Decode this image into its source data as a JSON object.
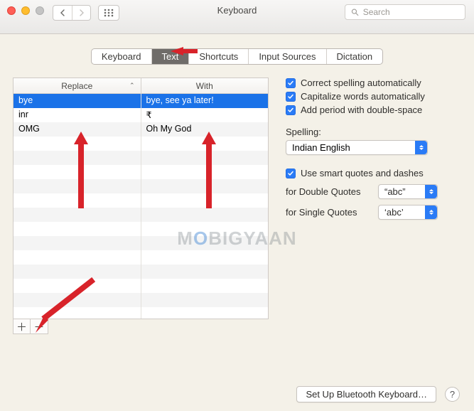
{
  "window": {
    "title": "Keyboard"
  },
  "search": {
    "placeholder": "Search"
  },
  "tabs": [
    "Keyboard",
    "Text",
    "Shortcuts",
    "Input Sources",
    "Dictation"
  ],
  "active_tab_index": 1,
  "replace_table": {
    "headers": {
      "replace": "Replace",
      "with": "With"
    },
    "rows": [
      {
        "replace": "bye",
        "with": "bye, see ya later!",
        "selected": true
      },
      {
        "replace": "inr",
        "with": "₹",
        "selected": false
      },
      {
        "replace": "OMG",
        "with": "Oh My God",
        "selected": false
      }
    ]
  },
  "options": {
    "correct_spelling": {
      "label": "Correct spelling automatically",
      "checked": true
    },
    "capitalize_words": {
      "label": "Capitalize words automatically",
      "checked": true
    },
    "add_period": {
      "label": "Add period with double-space",
      "checked": true
    },
    "spelling_label": "Spelling:",
    "spelling_value": "Indian English",
    "smart_quotes": {
      "label": "Use smart quotes and dashes",
      "checked": true
    },
    "double_quotes": {
      "label": "for Double Quotes",
      "value": "“abc”"
    },
    "single_quotes": {
      "label": "for Single Quotes",
      "value": "‘abc’"
    }
  },
  "footer": {
    "bluetooth_button": "Set Up Bluetooth Keyboard…"
  },
  "watermark": {
    "m": "M",
    "o": "O",
    "rest": "BIGYAAN"
  }
}
